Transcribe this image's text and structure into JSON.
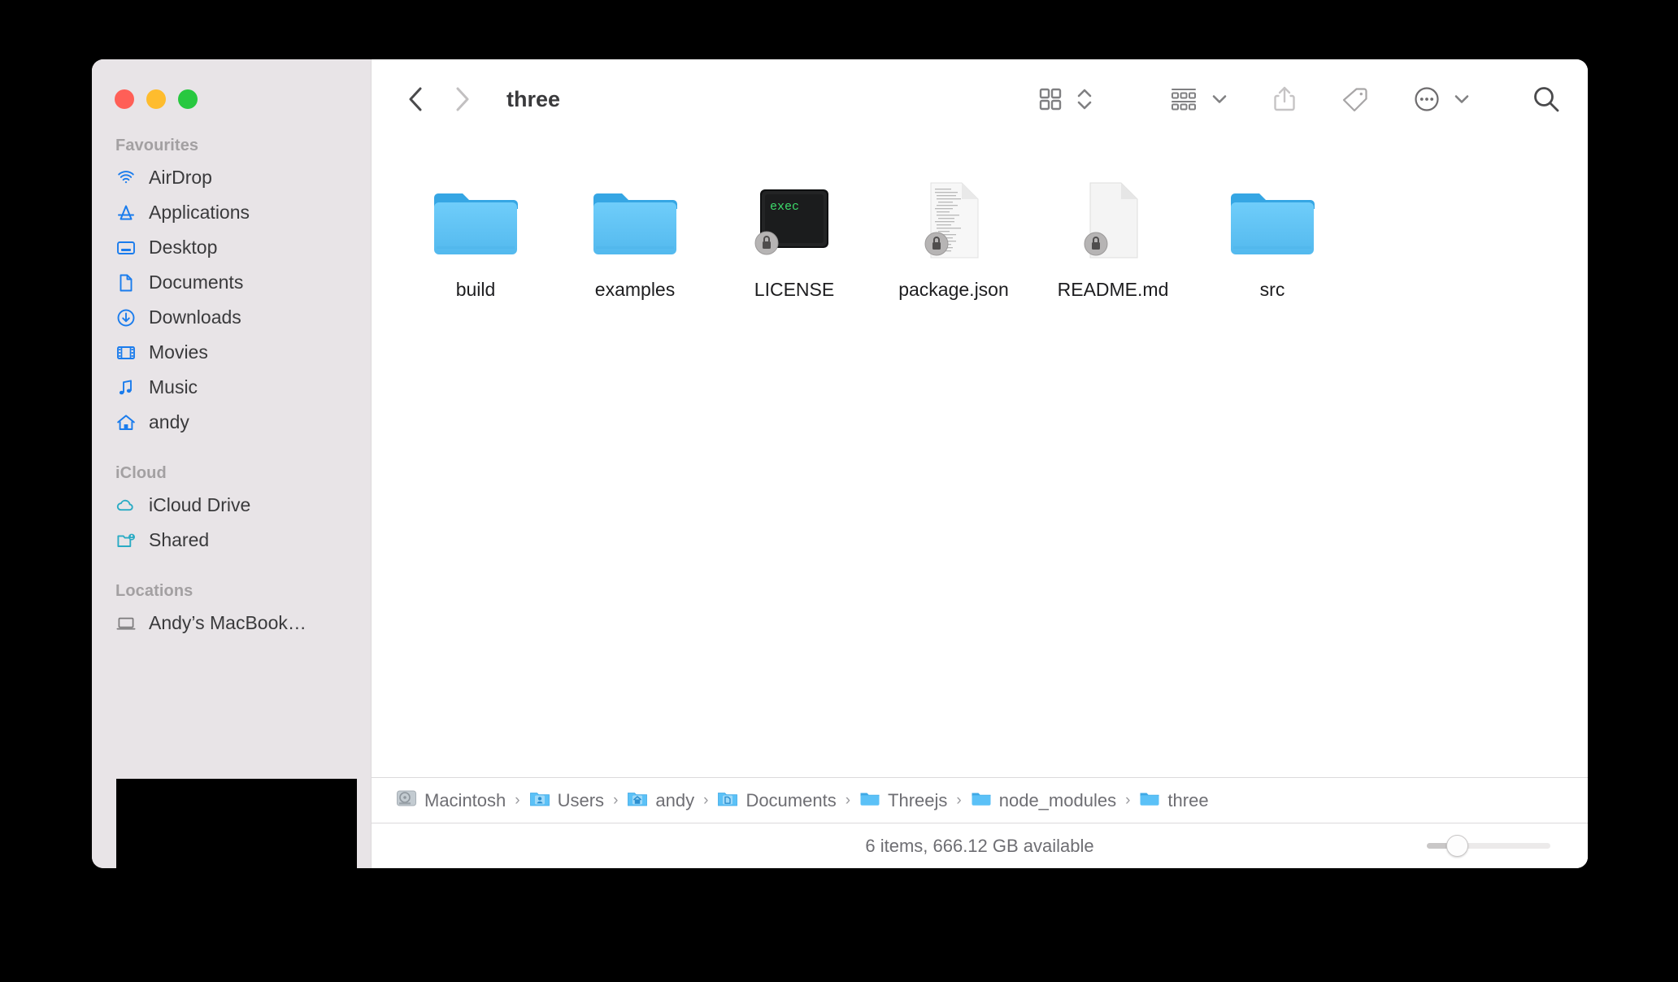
{
  "window": {
    "title": "three",
    "traffic_lights": [
      {
        "name": "close",
        "color": "#ff5f57"
      },
      {
        "name": "minimize",
        "color": "#febc2e"
      },
      {
        "name": "maximize",
        "color": "#28c840"
      }
    ]
  },
  "sidebar": {
    "sections": [
      {
        "label": "Favourites",
        "items": [
          {
            "label": "AirDrop",
            "icon": "airdrop-icon",
            "color": "#1a7ced"
          },
          {
            "label": "Applications",
            "icon": "applications-icon",
            "color": "#1a7ced"
          },
          {
            "label": "Desktop",
            "icon": "desktop-icon",
            "color": "#1a7ced"
          },
          {
            "label": "Documents",
            "icon": "documents-icon",
            "color": "#1a7ced"
          },
          {
            "label": "Downloads",
            "icon": "downloads-icon",
            "color": "#1a7ced"
          },
          {
            "label": "Movies",
            "icon": "movies-icon",
            "color": "#1a7ced"
          },
          {
            "label": "Music",
            "icon": "music-icon",
            "color": "#1a7ced"
          },
          {
            "label": "andy",
            "icon": "home-icon",
            "color": "#1a7ced"
          }
        ]
      },
      {
        "label": "iCloud",
        "items": [
          {
            "label": "iCloud Drive",
            "icon": "cloud-icon",
            "color": "#2aabc4"
          },
          {
            "label": "Shared",
            "icon": "shared-folder-icon",
            "color": "#2aabc4"
          }
        ]
      },
      {
        "label": "Locations",
        "items": [
          {
            "label": "Andy’s MacBook…",
            "icon": "laptop-icon",
            "color": "#7c7a7c"
          }
        ]
      }
    ]
  },
  "toolbar": {
    "back": "back-button",
    "forward": "forward-button",
    "view_mode": "icon-view",
    "group_by": "group-by",
    "share": "share",
    "tags": "tags",
    "more": "more-options",
    "search": "search"
  },
  "files": [
    {
      "name": "build",
      "type": "folder",
      "locked": false
    },
    {
      "name": "examples",
      "type": "folder",
      "locked": false
    },
    {
      "name": "LICENSE",
      "type": "unix-executable",
      "locked": true,
      "badge_text": "exec"
    },
    {
      "name": "package.json",
      "type": "text-document",
      "locked": true
    },
    {
      "name": "README.md",
      "type": "blank-document",
      "locked": true
    },
    {
      "name": "src",
      "type": "folder",
      "locked": false
    }
  ],
  "path_bar": {
    "crumbs": [
      {
        "label": "Macintosh",
        "icon": "hard-drive-icon"
      },
      {
        "label": "Users",
        "icon": "users-folder-icon"
      },
      {
        "label": "andy",
        "icon": "home-folder-icon"
      },
      {
        "label": "Documents",
        "icon": "documents-folder-icon"
      },
      {
        "label": "Threejs",
        "icon": "folder-icon"
      },
      {
        "label": "node_modules",
        "icon": "folder-icon"
      },
      {
        "label": "three",
        "icon": "folder-icon"
      }
    ],
    "separator": "›"
  },
  "status_bar": {
    "text": "6 items, 666.12 GB available",
    "zoom_value": 16
  },
  "colors": {
    "sidebar_bg": "#e8e4e7",
    "content_bg": "#ffffff",
    "folder_blue": "#59c0f7",
    "folder_tab": "#36a8e8",
    "accent_blue": "#1a7ced",
    "icloud_teal": "#2aabc4"
  }
}
